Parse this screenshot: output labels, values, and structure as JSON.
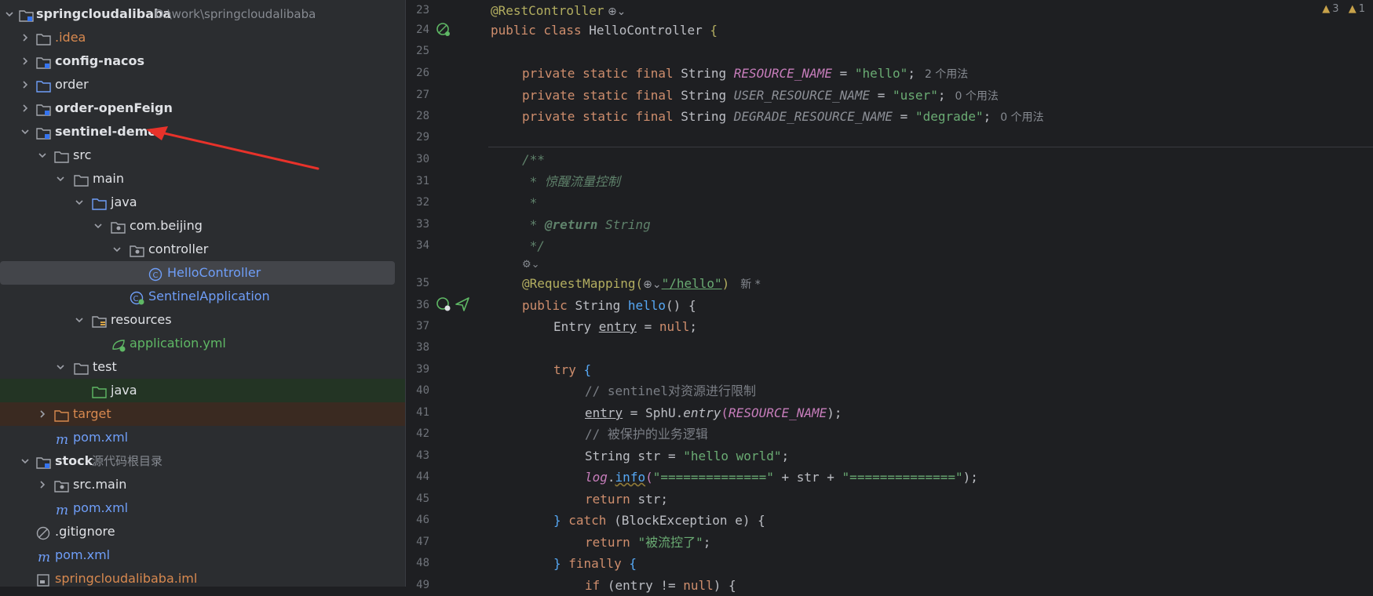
{
  "project_tree": {
    "root": {
      "name": "springcloudalibaba",
      "path": "D:\\work\\springcloudalibaba"
    },
    "items": [
      {
        "label": ".idea"
      },
      {
        "label": "config-nacos"
      },
      {
        "label": "order"
      },
      {
        "label": "order-openFeign"
      },
      {
        "label": "sentinel-demo"
      },
      {
        "label": "src"
      },
      {
        "label": "main"
      },
      {
        "label": "java"
      },
      {
        "label": "com.beijing"
      },
      {
        "label": "controller"
      },
      {
        "label": "HelloController"
      },
      {
        "label": "SentinelApplication"
      },
      {
        "label": "resources"
      },
      {
        "label": "application.yml"
      },
      {
        "label": "test"
      },
      {
        "label": "java"
      },
      {
        "label": "target"
      },
      {
        "label": "pom.xml"
      },
      {
        "label": "stock",
        "hint": "源代码根目录"
      },
      {
        "label": "src.main"
      },
      {
        "label": "pom.xml"
      },
      {
        "label": ".gitignore"
      },
      {
        "label": "pom.xml"
      },
      {
        "label": "springcloudalibaba.iml"
      }
    ]
  },
  "editor": {
    "line_numbers": [
      "23",
      "24",
      "25",
      "26",
      "27",
      "28",
      "29",
      "30",
      "31",
      "32",
      "33",
      "34",
      "35",
      "36",
      "37",
      "38",
      "39",
      "40",
      "41",
      "42",
      "43",
      "44",
      "45",
      "46",
      "47",
      "48",
      "49"
    ],
    "problems": {
      "warnings": "3",
      "weak_warnings": "1"
    },
    "code": {
      "l23_ann": "@RestController",
      "l24_kw": "public class ",
      "l24_cls": "HelloController ",
      "l24_brace": "{",
      "kw_psf": "private static final ",
      "type_string": "String ",
      "l26_field": "RESOURCE_NAME",
      "l26_str": "\"hello\"",
      "l26_hint": "2 个用法",
      "l27_field": "USER_RESOURCE_NAME",
      "l27_str": "\"user\"",
      "l27_hint": "0 个用法",
      "l28_field": "DEGRADE_RESOURCE_NAME",
      "l28_str": "\"degrade\"",
      "l28_hint": "0 个用法",
      "eq": " = ",
      "semi": ";",
      "l30": "/**",
      "l31": " * 惊醒流量控制",
      "l32": " *",
      "l33_star": " * ",
      "l33_tag": "@return",
      "l33_rest": " String",
      "l34": " */",
      "l35_ann": "@RequestMapping(",
      "l35_str": "\"/hello\"",
      "l35_close": ")",
      "l35_hint": "新 *",
      "l36_kw": "public ",
      "l36_type": "String ",
      "l36_m": "hello",
      "l36_rest": "() {",
      "l37_type": "Entry ",
      "l37_var": "entry",
      "l37_eq": " = ",
      "l37_null": "null",
      "l39_kw": "try ",
      "l39_brace": "{",
      "l40": "// sentinel对资源进行限制",
      "l41_var": "entry",
      "l41_eq": " = SphU.",
      "l41_m": "entry",
      "l41_open": "(",
      "l41_field": "RESOURCE_NAME",
      "l41_close": ");",
      "l42": "// 被保护的业务逻辑",
      "l43_a": "String str = ",
      "l43_str": "\"hello world\"",
      "l44_log": "log",
      "l44_dot": ".",
      "l44_info": "info",
      "l44_open": "(",
      "l44_s1": "\"==============\"",
      "l44_mid": " + str + ",
      "l44_s2": "\"==============\"",
      "l44_close": ");",
      "l45_kw": "return ",
      "l45_rest": "str;",
      "l46_a": "} ",
      "l46_kw": "catch ",
      "l46_rest": "(BlockException e) {",
      "l47_kw": "return ",
      "l47_str": "\"被流控了\"",
      "l48_a": "} ",
      "l48_kw": "finally ",
      "l48_brace": "{",
      "l49_kw": "if ",
      "l49_rest": "(entry != ",
      "l49_null": "null",
      "l49_end": ") {"
    }
  },
  "colors": {
    "annotation_arrow": "#e8322a",
    "accent": "#6f9ef8"
  }
}
